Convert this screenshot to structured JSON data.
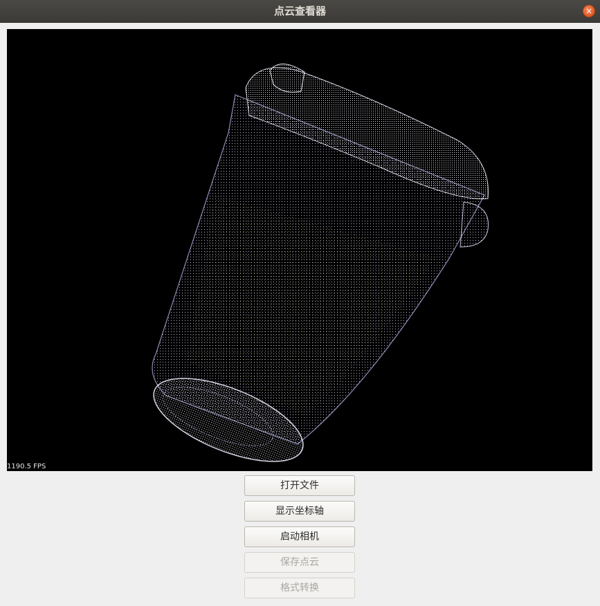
{
  "window": {
    "title": "点云查看器"
  },
  "viewer": {
    "fps_text": "1190.5 FPS"
  },
  "buttons": [
    {
      "label": "打开文件",
      "enabled": true
    },
    {
      "label": "显示坐标轴",
      "enabled": true
    },
    {
      "label": "启动相机",
      "enabled": true
    },
    {
      "label": "保存点云",
      "enabled": false
    },
    {
      "label": "格式转换",
      "enabled": false
    }
  ],
  "colors": {
    "titlebar": "#3c3b37",
    "close_button": "#e95420",
    "viewer_background": "#000000",
    "point_cloud": "#c8c8dc"
  },
  "icons": {
    "close": "close-icon"
  }
}
